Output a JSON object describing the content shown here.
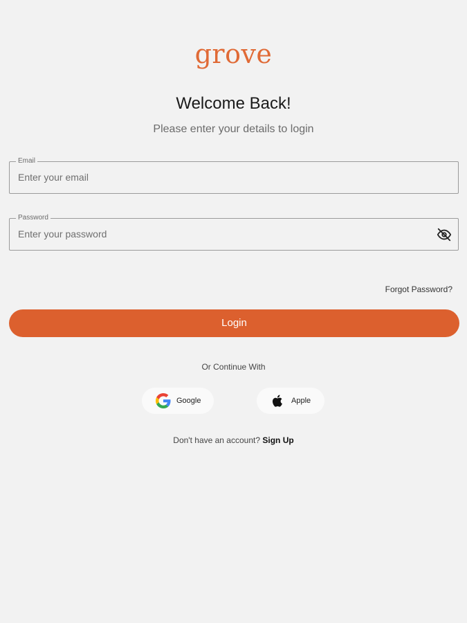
{
  "brand": {
    "logo_text": "grove",
    "accent_color": "#dc602e"
  },
  "header": {
    "title": "Welcome Back!",
    "subtitle": "Please enter your details to login"
  },
  "form": {
    "email": {
      "label": "Email",
      "placeholder": "Enter your email",
      "value": ""
    },
    "password": {
      "label": "Password",
      "placeholder": "Enter your password",
      "value": "",
      "toggle_icon": "eye-off-icon"
    },
    "forgot_password": "Forgot Password?",
    "login_label": "Login"
  },
  "social": {
    "divider_text": "Or Continue With",
    "providers": [
      {
        "label": "Google",
        "icon": "google-icon"
      },
      {
        "label": "Apple",
        "icon": "apple-icon"
      }
    ]
  },
  "footer": {
    "prompt": "Don't have an account?",
    "signup_label": "Sign Up"
  }
}
